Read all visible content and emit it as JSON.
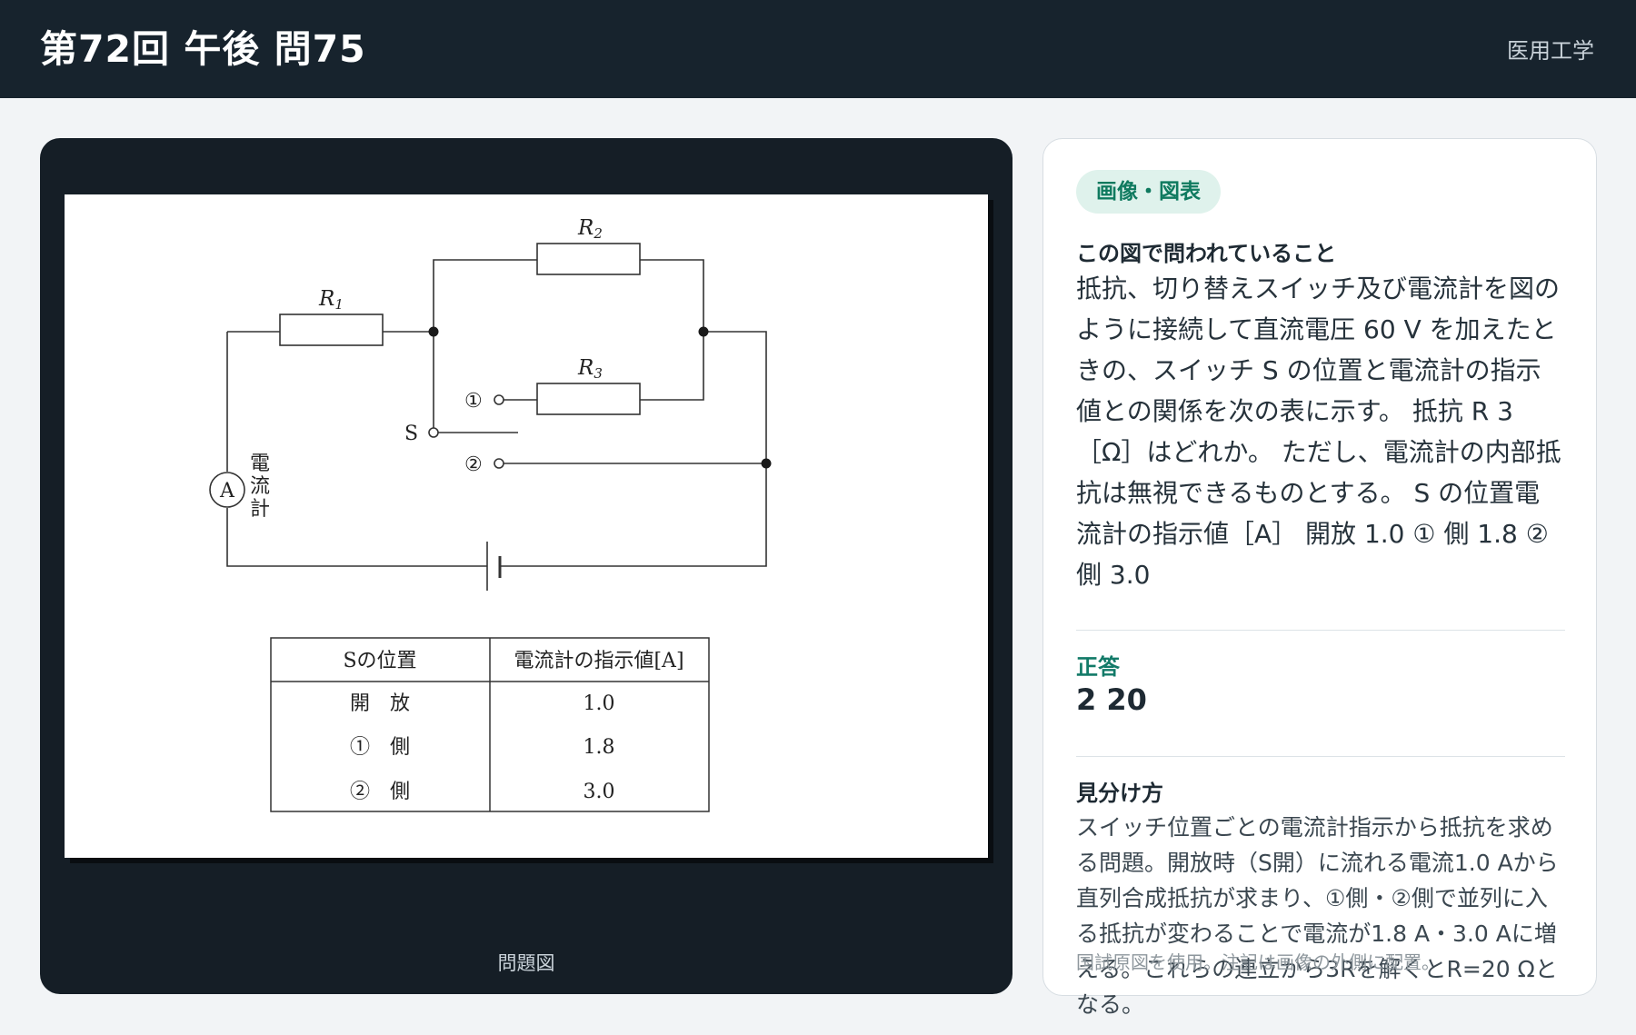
{
  "header": {
    "title": "第72回 午後 問75",
    "category": "医用工学"
  },
  "figure": {
    "caption": "問題図",
    "circuit": {
      "r1": "R",
      "r1_sub": "1",
      "r2": "R",
      "r2_sub": "2",
      "r3": "R",
      "r3_sub": "3",
      "pos1": "①",
      "pos2": "②",
      "switch": "S",
      "ammeter": "A",
      "ammeter_label_1": "電",
      "ammeter_label_2": "流",
      "ammeter_label_3": "計"
    },
    "table": {
      "headers": [
        "Sの位置",
        "電流計の指示値[A]"
      ],
      "rows": [
        [
          "開　放",
          "1.0"
        ],
        [
          "①　側",
          "1.8"
        ],
        [
          "②　側",
          "3.0"
        ]
      ]
    }
  },
  "panel": {
    "tag": "画像・図表",
    "question_heading": "この図で問われていること",
    "question_text": "抵抗、切り替えスイッチ及び電流計を図のように接続して直流電圧 60 V を加えたときの、スイッチ S の位置と電流計の指示値との関係を次の表に示す。 抵抗 R 3［Ω］はどれか。 ただし、電流計の内部抵抗は無視できるものとする。 S の位置電流計の指示値［A］ 開放 1.0 ① 側 1.8 ② 側 3.0",
    "answer_label": "正答",
    "answer_value": "2 20",
    "hint_heading": "見分け方",
    "hint_text": "スイッチ位置ごとの電流計指示から抵抗を求める問題。開放時（S開）に流れる電流1.0 Aから直列合成抵抗が求まり、①側・②側で並列に入る抵抗が変わることで電流が1.8 A・3.0 Aに増える。これらの連立から3Rを解くとR=20 Ωとなる。",
    "footnote": "国試原図を使用。注記は画像の外側に配置。"
  }
}
